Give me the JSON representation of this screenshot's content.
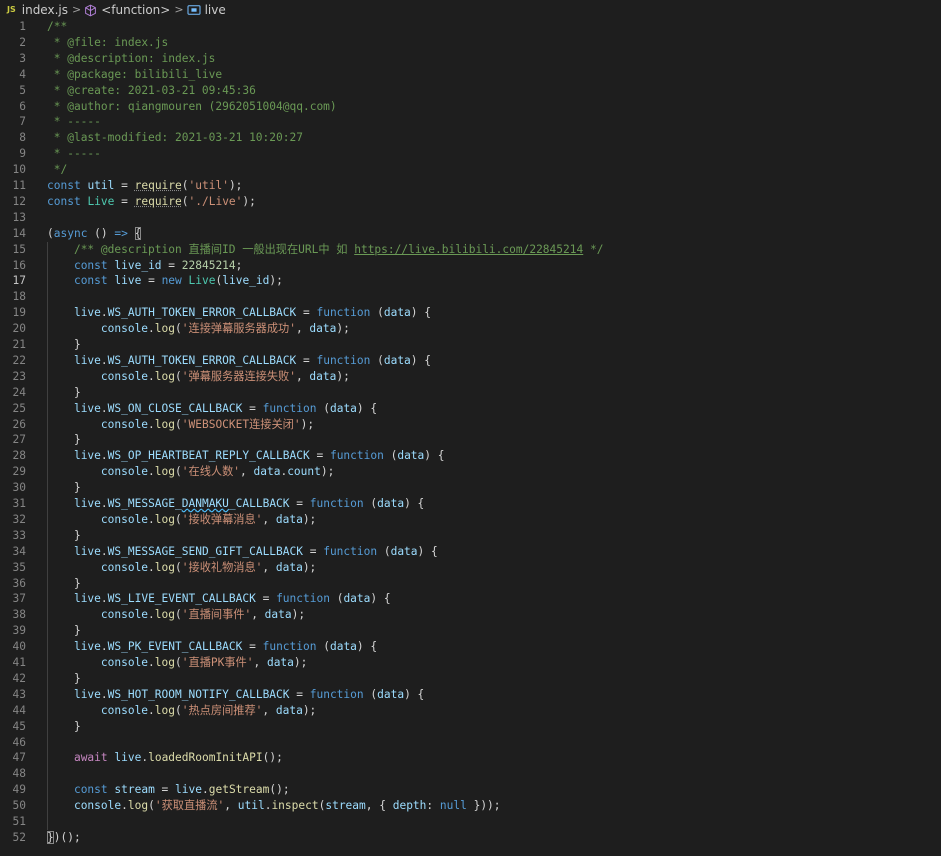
{
  "breadcrumb": {
    "file_badge": "JS",
    "file": "index.js",
    "scope": "<function>",
    "symbol": "live"
  },
  "editor": {
    "active_line": 17,
    "lines": [
      [
        [
          "c",
          "/**"
        ]
      ],
      [
        [
          "c",
          " * "
        ],
        [
          "c",
          "@file"
        ],
        [
          "c",
          ": index.js"
        ]
      ],
      [
        [
          "c",
          " * "
        ],
        [
          "c",
          "@description"
        ],
        [
          "c",
          ": index.js"
        ]
      ],
      [
        [
          "c",
          " * "
        ],
        [
          "c",
          "@package"
        ],
        [
          "c",
          ": bilibili_live"
        ]
      ],
      [
        [
          "c",
          " * "
        ],
        [
          "c",
          "@create"
        ],
        [
          "c",
          ": 2021-03-21 09:45:36"
        ]
      ],
      [
        [
          "c",
          " * "
        ],
        [
          "c",
          "@author"
        ],
        [
          "c",
          ": qiangmouren (2962051004@qq.com)"
        ]
      ],
      [
        [
          "c",
          " * -----"
        ]
      ],
      [
        [
          "c",
          " * "
        ],
        [
          "c",
          "@last-modified"
        ],
        [
          "c",
          ": 2021-03-21 10:20:27"
        ]
      ],
      [
        [
          "c",
          " * -----"
        ]
      ],
      [
        [
          "c",
          " */"
        ]
      ],
      [
        [
          "k",
          "const"
        ],
        [
          "p",
          " "
        ],
        [
          "v",
          "util"
        ],
        [
          "p",
          " = "
        ],
        [
          "f dots",
          "require"
        ],
        [
          "p",
          "("
        ],
        [
          "s",
          "'util'"
        ],
        [
          "p",
          ");"
        ]
      ],
      [
        [
          "k",
          "const"
        ],
        [
          "p",
          " "
        ],
        [
          "t",
          "Live"
        ],
        [
          "p",
          " = "
        ],
        [
          "f dots",
          "require"
        ],
        [
          "p",
          "("
        ],
        [
          "s",
          "'./Live'"
        ],
        [
          "p",
          ");"
        ]
      ],
      [],
      [
        [
          "p",
          "("
        ],
        [
          "k",
          "async"
        ],
        [
          "p",
          " () "
        ],
        [
          "k",
          "=>"
        ],
        [
          "p",
          " "
        ],
        [
          "p br",
          "{"
        ]
      ],
      [
        [
          "p",
          "    "
        ],
        [
          "c",
          "/** @description 直播间ID 一般出现在URL中 如 "
        ],
        [
          "c u",
          "https://live.bilibili.com/22845214"
        ],
        [
          "c",
          " */"
        ]
      ],
      [
        [
          "p",
          "    "
        ],
        [
          "k",
          "const"
        ],
        [
          "p",
          " "
        ],
        [
          "v",
          "live_id"
        ],
        [
          "p",
          " = "
        ],
        [
          "n",
          "22845214"
        ],
        [
          "p",
          ";"
        ]
      ],
      [
        [
          "p",
          "    "
        ],
        [
          "k",
          "const"
        ],
        [
          "p",
          " "
        ],
        [
          "v",
          "live"
        ],
        [
          "p",
          " = "
        ],
        [
          "k",
          "new"
        ],
        [
          "p",
          " "
        ],
        [
          "t",
          "Live"
        ],
        [
          "p",
          "("
        ],
        [
          "v",
          "live_id"
        ],
        [
          "p",
          ");"
        ]
      ],
      [],
      [
        [
          "p",
          "    "
        ],
        [
          "v",
          "live"
        ],
        [
          "p",
          "."
        ],
        [
          "v",
          "WS_AUTH_TOKEN_ERROR_CALLBACK"
        ],
        [
          "p",
          " = "
        ],
        [
          "k",
          "function"
        ],
        [
          "p",
          " ("
        ],
        [
          "v",
          "data"
        ],
        [
          "p",
          ") {"
        ]
      ],
      [
        [
          "p",
          "        "
        ],
        [
          "v",
          "console"
        ],
        [
          "p",
          "."
        ],
        [
          "f",
          "log"
        ],
        [
          "p",
          "("
        ],
        [
          "s",
          "'连接弹幕服务器成功'"
        ],
        [
          "p",
          ", "
        ],
        [
          "v",
          "data"
        ],
        [
          "p",
          ");"
        ]
      ],
      [
        [
          "p",
          "    }"
        ]
      ],
      [
        [
          "p",
          "    "
        ],
        [
          "v",
          "live"
        ],
        [
          "p",
          "."
        ],
        [
          "v",
          "WS_AUTH_TOKEN_ERROR_CALLBACK"
        ],
        [
          "p",
          " = "
        ],
        [
          "k",
          "function"
        ],
        [
          "p",
          " ("
        ],
        [
          "v",
          "data"
        ],
        [
          "p",
          ") {"
        ]
      ],
      [
        [
          "p",
          "        "
        ],
        [
          "v",
          "console"
        ],
        [
          "p",
          "."
        ],
        [
          "f",
          "log"
        ],
        [
          "p",
          "("
        ],
        [
          "s",
          "'弹幕服务器连接失败'"
        ],
        [
          "p",
          ", "
        ],
        [
          "v",
          "data"
        ],
        [
          "p",
          ");"
        ]
      ],
      [
        [
          "p",
          "    }"
        ]
      ],
      [
        [
          "p",
          "    "
        ],
        [
          "v",
          "live"
        ],
        [
          "p",
          "."
        ],
        [
          "v",
          "WS_ON_CLOSE_CALLBACK"
        ],
        [
          "p",
          " = "
        ],
        [
          "k",
          "function"
        ],
        [
          "p",
          " ("
        ],
        [
          "v",
          "data"
        ],
        [
          "p",
          ") {"
        ]
      ],
      [
        [
          "p",
          "        "
        ],
        [
          "v",
          "console"
        ],
        [
          "p",
          "."
        ],
        [
          "f",
          "log"
        ],
        [
          "p",
          "("
        ],
        [
          "s",
          "'WEBSOCKET连接关闭'"
        ],
        [
          "p",
          ");"
        ]
      ],
      [
        [
          "p",
          "    }"
        ]
      ],
      [
        [
          "p",
          "    "
        ],
        [
          "v",
          "live"
        ],
        [
          "p",
          "."
        ],
        [
          "v",
          "WS_OP_HEARTBEAT_REPLY_CALLBACK"
        ],
        [
          "p",
          " = "
        ],
        [
          "k",
          "function"
        ],
        [
          "p",
          " ("
        ],
        [
          "v",
          "data"
        ],
        [
          "p",
          ") {"
        ]
      ],
      [
        [
          "p",
          "        "
        ],
        [
          "v",
          "console"
        ],
        [
          "p",
          "."
        ],
        [
          "f",
          "log"
        ],
        [
          "p",
          "("
        ],
        [
          "s",
          "'在线人数'"
        ],
        [
          "p",
          ", "
        ],
        [
          "v",
          "data"
        ],
        [
          "p",
          "."
        ],
        [
          "v",
          "count"
        ],
        [
          "p",
          ");"
        ]
      ],
      [
        [
          "p",
          "    }"
        ]
      ],
      [
        [
          "p",
          "    "
        ],
        [
          "v",
          "live"
        ],
        [
          "p",
          "."
        ],
        [
          "v",
          "WS_MESSAGE_"
        ],
        [
          "v sq",
          "DANMAKU"
        ],
        [
          "v",
          "_CALLBACK"
        ],
        [
          "p",
          " = "
        ],
        [
          "k",
          "function"
        ],
        [
          "p",
          " ("
        ],
        [
          "v",
          "data"
        ],
        [
          "p",
          ") {"
        ]
      ],
      [
        [
          "p",
          "        "
        ],
        [
          "v",
          "console"
        ],
        [
          "p",
          "."
        ],
        [
          "f",
          "log"
        ],
        [
          "p",
          "("
        ],
        [
          "s",
          "'接收弹幕消息'"
        ],
        [
          "p",
          ", "
        ],
        [
          "v",
          "data"
        ],
        [
          "p",
          ");"
        ]
      ],
      [
        [
          "p",
          "    }"
        ]
      ],
      [
        [
          "p",
          "    "
        ],
        [
          "v",
          "live"
        ],
        [
          "p",
          "."
        ],
        [
          "v",
          "WS_MESSAGE_SEND_GIFT_CALLBACK"
        ],
        [
          "p",
          " = "
        ],
        [
          "k",
          "function"
        ],
        [
          "p",
          " ("
        ],
        [
          "v",
          "data"
        ],
        [
          "p",
          ") {"
        ]
      ],
      [
        [
          "p",
          "        "
        ],
        [
          "v",
          "console"
        ],
        [
          "p",
          "."
        ],
        [
          "f",
          "log"
        ],
        [
          "p",
          "("
        ],
        [
          "s",
          "'接收礼物消息'"
        ],
        [
          "p",
          ", "
        ],
        [
          "v",
          "data"
        ],
        [
          "p",
          ");"
        ]
      ],
      [
        [
          "p",
          "    }"
        ]
      ],
      [
        [
          "p",
          "    "
        ],
        [
          "v",
          "live"
        ],
        [
          "p",
          "."
        ],
        [
          "v",
          "WS_LIVE_EVENT_CALLBACK"
        ],
        [
          "p",
          " = "
        ],
        [
          "k",
          "function"
        ],
        [
          "p",
          " ("
        ],
        [
          "v",
          "data"
        ],
        [
          "p",
          ") {"
        ]
      ],
      [
        [
          "p",
          "        "
        ],
        [
          "v",
          "console"
        ],
        [
          "p",
          "."
        ],
        [
          "f",
          "log"
        ],
        [
          "p",
          "("
        ],
        [
          "s",
          "'直播间事件'"
        ],
        [
          "p",
          ", "
        ],
        [
          "v",
          "data"
        ],
        [
          "p",
          ");"
        ]
      ],
      [
        [
          "p",
          "    }"
        ]
      ],
      [
        [
          "p",
          "    "
        ],
        [
          "v",
          "live"
        ],
        [
          "p",
          "."
        ],
        [
          "v",
          "WS_PK_EVENT_CALLBACK"
        ],
        [
          "p",
          " = "
        ],
        [
          "k",
          "function"
        ],
        [
          "p",
          " ("
        ],
        [
          "v",
          "data"
        ],
        [
          "p",
          ") {"
        ]
      ],
      [
        [
          "p",
          "        "
        ],
        [
          "v",
          "console"
        ],
        [
          "p",
          "."
        ],
        [
          "f",
          "log"
        ],
        [
          "p",
          "("
        ],
        [
          "s",
          "'直播PK事件'"
        ],
        [
          "p",
          ", "
        ],
        [
          "v",
          "data"
        ],
        [
          "p",
          ");"
        ]
      ],
      [
        [
          "p",
          "    }"
        ]
      ],
      [
        [
          "p",
          "    "
        ],
        [
          "v",
          "live"
        ],
        [
          "p",
          "."
        ],
        [
          "v",
          "WS_HOT_ROOM_NOTIFY_CALLBACK"
        ],
        [
          "p",
          " = "
        ],
        [
          "k",
          "function"
        ],
        [
          "p",
          " ("
        ],
        [
          "v",
          "data"
        ],
        [
          "p",
          ") {"
        ]
      ],
      [
        [
          "p",
          "        "
        ],
        [
          "v",
          "console"
        ],
        [
          "p",
          "."
        ],
        [
          "f",
          "log"
        ],
        [
          "p",
          "("
        ],
        [
          "s",
          "'热点房间推荐'"
        ],
        [
          "p",
          ", "
        ],
        [
          "v",
          "data"
        ],
        [
          "p",
          ");"
        ]
      ],
      [
        [
          "p",
          "    }"
        ]
      ],
      [],
      [
        [
          "p",
          "    "
        ],
        [
          "ctl",
          "await"
        ],
        [
          "p",
          " "
        ],
        [
          "v",
          "live"
        ],
        [
          "p",
          "."
        ],
        [
          "f",
          "loadedRoomInitAPI"
        ],
        [
          "p",
          "();"
        ]
      ],
      [],
      [
        [
          "p",
          "    "
        ],
        [
          "k",
          "const"
        ],
        [
          "p",
          " "
        ],
        [
          "v",
          "stream"
        ],
        [
          "p",
          " = "
        ],
        [
          "v",
          "live"
        ],
        [
          "p",
          "."
        ],
        [
          "f",
          "getStream"
        ],
        [
          "p",
          "();"
        ]
      ],
      [
        [
          "p",
          "    "
        ],
        [
          "v",
          "console"
        ],
        [
          "p",
          "."
        ],
        [
          "f",
          "log"
        ],
        [
          "p",
          "("
        ],
        [
          "s",
          "'获取直播流'"
        ],
        [
          "p",
          ", "
        ],
        [
          "v",
          "util"
        ],
        [
          "p",
          "."
        ],
        [
          "f",
          "inspect"
        ],
        [
          "p",
          "("
        ],
        [
          "v",
          "stream"
        ],
        [
          "p",
          ", { "
        ],
        [
          "v",
          "depth"
        ],
        [
          "p",
          ": "
        ],
        [
          "k",
          "null"
        ],
        [
          "p",
          " }));"
        ]
      ],
      [],
      [
        [
          "p br",
          "}"
        ],
        [
          "p",
          ")();"
        ]
      ]
    ]
  }
}
